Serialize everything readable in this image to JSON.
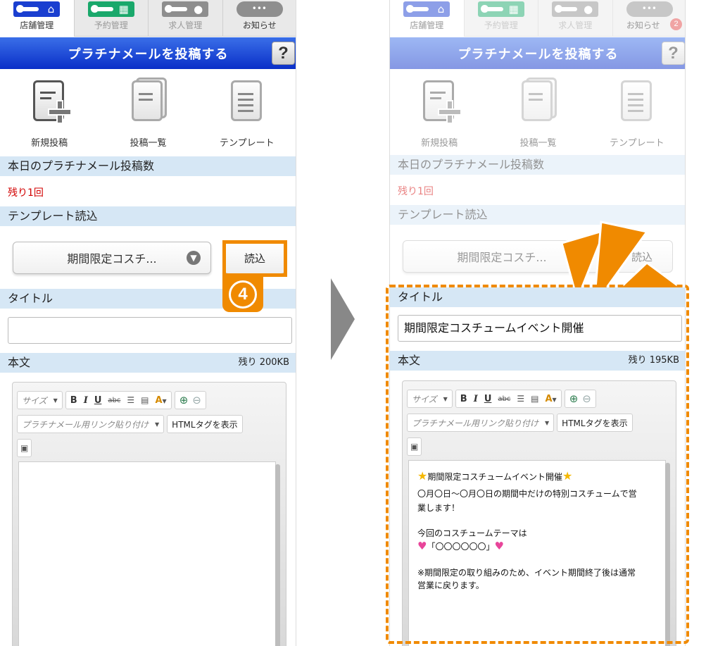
{
  "tabs": [
    {
      "label": "店舗管理",
      "icon": "key-store-icon",
      "color": "#1a3fd0"
    },
    {
      "label": "予約管理",
      "icon": "key-calendar-icon",
      "color": "#1aa86b"
    },
    {
      "label": "求人管理",
      "icon": "key-person-icon",
      "color": "#8e8e8e"
    },
    {
      "label": "お知らせ",
      "icon": "speech-bubble-icon",
      "color": "#8e8e8e"
    }
  ],
  "notification_count": "2",
  "header": {
    "title": "プラチナメールを投稿する",
    "help": "?"
  },
  "actions": [
    {
      "label": "新規投稿"
    },
    {
      "label": "投稿一覧"
    },
    {
      "label": "テンプレート"
    }
  ],
  "count_section": {
    "title": "本日のプラチナメール投稿数",
    "remaining": "残り1回"
  },
  "template_section": {
    "title": "テンプレート読込",
    "selected": "期間限定コスチ...",
    "load_button": "読込"
  },
  "title_section": {
    "label": "タイトル"
  },
  "body_section": {
    "label": "本文"
  },
  "left": {
    "title_value": "",
    "remaining_kb": "残り 200KB"
  },
  "right": {
    "title_value": "期間限定コスチュームイベント開催",
    "remaining_kb": "残り 195KB"
  },
  "toolbar": {
    "size": "サイズ",
    "bold": "B",
    "italic": "I",
    "underline": "U",
    "strike": "abc",
    "font_color": "A",
    "link_select": "プラチナメール用リンク貼り付け",
    "html_button": "HTMLタグを表示"
  },
  "body_content": [
    "期間限定コスチュームイベント開催",
    "〇月〇日～〇月〇日の期間中だけの特別コスチュームで営",
    "業します！",
    "",
    "今回のコスチュームテーマは",
    "「〇〇〇〇〇〇」",
    "",
    "※期間限定の取り組みのため、イベント期間終了後は通常",
    "営業に戻ります。"
  ],
  "step_number": "4",
  "colors": {
    "accent": "#f08a00",
    "header_blue": "#0a2fc8",
    "section_bg": "#d6e7f5",
    "alert_red": "#d20000"
  }
}
